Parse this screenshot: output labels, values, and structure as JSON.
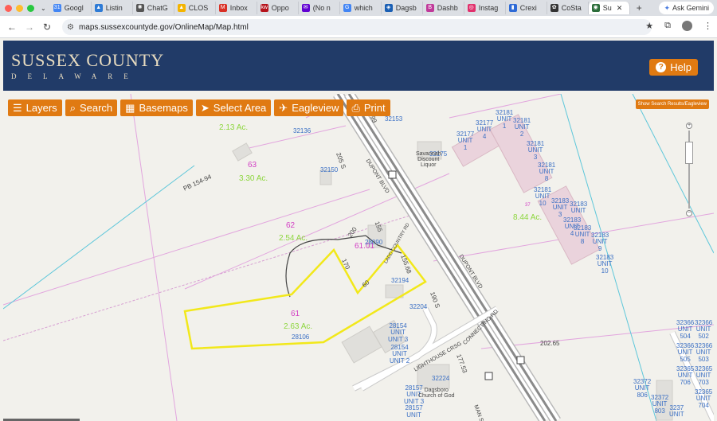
{
  "browser": {
    "tabs": [
      {
        "label": "Googl",
        "color": "#4285f4",
        "glyph": "31"
      },
      {
        "label": "Listin",
        "color": "#2e7bd6",
        "glyph": "▲"
      },
      {
        "label": "ChatG",
        "color": "#555555",
        "glyph": "✺"
      },
      {
        "label": "CLOS",
        "color": "#f4b400",
        "glyph": "▲"
      },
      {
        "label": "Inbox",
        "color": "#d93025",
        "glyph": "M"
      },
      {
        "label": "Oppo",
        "color": "#b5121b",
        "glyph": "kw"
      },
      {
        "label": "(No n",
        "color": "#6001d2",
        "glyph": "✉"
      },
      {
        "label": "which",
        "color": "#4285f4",
        "glyph": "G"
      },
      {
        "label": "Dagsb",
        "color": "#1a5fb4",
        "glyph": "◈"
      },
      {
        "label": "Dashb",
        "color": "#c03a9a",
        "glyph": "B"
      },
      {
        "label": "Instag",
        "color": "#e1306c",
        "glyph": "◎"
      },
      {
        "label": "Crexi",
        "color": "#2e6ad6",
        "glyph": "▮"
      },
      {
        "label": "CoSta",
        "color": "#333333",
        "glyph": "✿"
      },
      {
        "label": "Su",
        "color": "#2b6d3a",
        "glyph": "◉",
        "active": true
      }
    ],
    "tab_close": "✕",
    "new_tab": "+",
    "ask_gemini": "Ask Gemini",
    "url": "maps.sussexcountyde.gov/OnlineMap/Map.html"
  },
  "site": {
    "title": "SUSSEX COUNTY",
    "subtitle": "DELAWARE",
    "help": "Help"
  },
  "toolbar": {
    "layers": "Layers",
    "search": "Search",
    "basemaps": "Basemaps",
    "select_area": "Select Area",
    "eagleview": "Eagleview",
    "print": "Print",
    "show_search": "Show Search Results/Eagleview"
  },
  "map_labels": {
    "ac_213": "2.13 Ac.",
    "p63": "63",
    "ac_330": "3.30 Ac.",
    "p62": "62",
    "ac_254": "2.54 Ac.",
    "p61": "61",
    "ac_263": "2.63 Ac.",
    "p6101": "61.01",
    "ac_844": "8.44 Ac.",
    "n37": "37",
    "a32136": "32136",
    "a32150": "32150",
    "a32153": "32153",
    "a32175": "32175",
    "a28090": "28090",
    "a32194": "32194",
    "a32204": "32204",
    "a28106": "28106",
    "a32224": "32224",
    "u32177": "32177\nUNIT\n1",
    "u32177b": "32177\nUNIT\n4",
    "u32181a": "32181\nUNIT\n1",
    "u32181b": "32181\nUNIT\n2",
    "u32181c": "32181\nUNIT\n3",
    "u32181d": "32181\nUNIT\n8",
    "u32181e": "32181\nUNIT\n10",
    "u32183a": "32183\nUNIT\n3",
    "u32183b": "32183\nUNIT\n4",
    "u32183c": "32183\nUNIT\n8",
    "u32183d": "32183\nUNIT\n9",
    "u32183e": "32183\nUNIT\n10",
    "u32183f": "32183\nUNIT",
    "u28154a": "28154\nUNIT\nUNIT 3",
    "u28154b": "28154\nUNIT\nUNIT 2",
    "u28157": "28157\nUNIT\nUNIT 3\n28157\nUNIT",
    "u32366a": "32366\nUNIT\n504",
    "u32366b": "32366\nUNIT\n502",
    "u32366c": "32366\nUNIT\n505",
    "u32366d": "32366\nUNIT\n503",
    "u32365a": "32365\nUNIT\n706",
    "u32365b": "32365\nUNIT\n703",
    "u32365c": "32365\nUNIT\n704",
    "u32372a": "32372\nUNIT\n806",
    "u32372b": "32372\nUNIT\n803",
    "u3237": "3237\nUNIT",
    "savannah": "Savannah\nDiscount\nLiquor",
    "church": "Dagsboro\nChurch of God",
    "pb": "PB 154-94",
    "dupont1": "DUPONT BLVD",
    "dupont2": "DUPONT BLVD",
    "lighthouse": "LIGHTHOUSE CRSG",
    "connecting": "CONNECTING RD",
    "r202": "202.65",
    "r200": "200",
    "r155": "155",
    "r170": "170",
    "r60": "60",
    "r15568": "155.68",
    "r205": "205 S",
    "r190": "190 S",
    "r17753": "177.53",
    "r99": "99",
    "ladd": "LADD COUNTRY RD",
    "man": "MAN ST"
  }
}
